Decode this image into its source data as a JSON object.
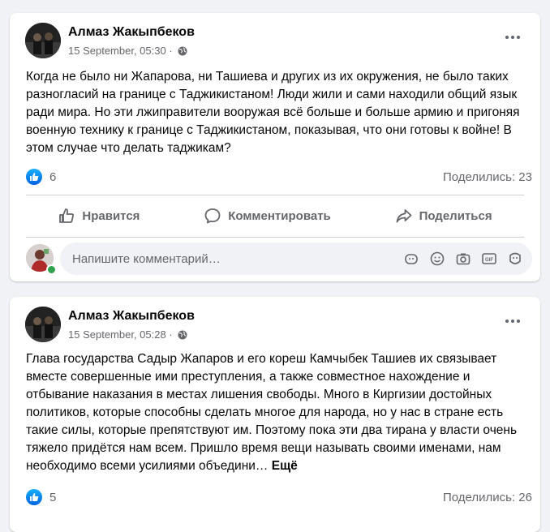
{
  "posts": [
    {
      "author": "Алмаз Жакыпбеков",
      "timestamp": "15 September, 05:30 ·",
      "text": "Когда не было ни Жапарова, ни Ташиева и других из их окружения, не было таких разногласий на границе с Таджикистаном! Люди жили и сами находили общий язык ради мира. Но эти лжиправители вооружая всё больше и больше армию и пригоняя военную технику к границе с Таджикистаном, показывая, что они готовы к войне! В этом случае что делать таджикам?",
      "likes": "6",
      "shares": "Поделились: 23",
      "actions": {
        "like": "Нравится",
        "comment": "Комментировать",
        "share": "Поделиться"
      },
      "comment_placeholder": "Напишите комментарий…"
    },
    {
      "author": "Алмаз Жакыпбеков",
      "timestamp": "15 September, 05:28 ·",
      "text": "Глава государства Садыр Жапаров и его кореш Камчыбек Ташиев их связывает вместе совершенные ими преступления, а также совместное нахождение и отбывание наказания в местах лишения свободы. Много в Киргизии достойных политиков, которые способны сделать многое для народа, но у нас в стране есть такие силы, которые препятствуют им. Поэтому пока эти два тирана у власти очень тяжело придётся нам всем. Пришло время вещи называть своими именами, нам необходимо всеми усилиями объедини…",
      "see_more": "Ещё",
      "likes": "5",
      "shares": "Поделились: 26"
    }
  ],
  "colors": {
    "accent": "#1877f2",
    "secondary_text": "#65676b",
    "page_bg": "#f0f2f5"
  },
  "icons": [
    "globe-icon",
    "more-icon",
    "like-badge-icon",
    "thumbs-up-icon",
    "comment-icon",
    "share-icon",
    "sticker-icon",
    "emoji-icon",
    "camera-icon",
    "gif-icon",
    "avatar-sticker-icon"
  ]
}
